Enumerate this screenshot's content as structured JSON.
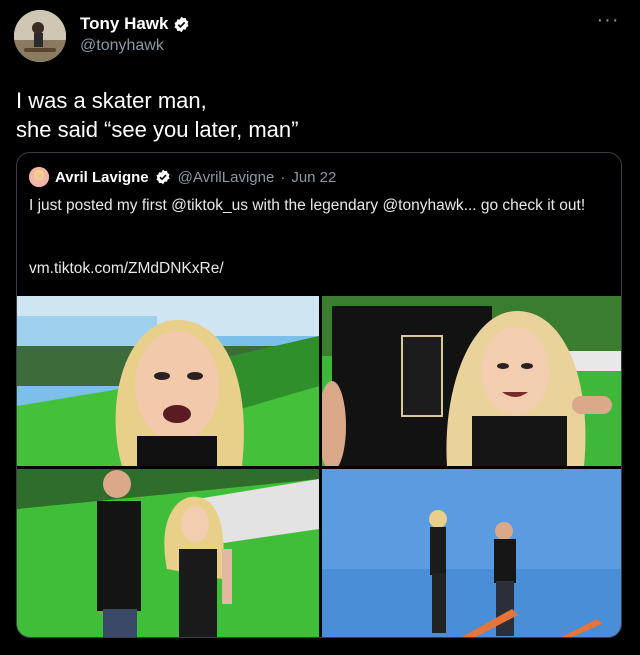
{
  "author": {
    "name": "Tony Hawk",
    "handle": "@tonyhawk",
    "verified": true
  },
  "tweet": {
    "lines": [
      "I was a skater man,",
      "she said “see you later, man”"
    ]
  },
  "quoted": {
    "name": "Avril Lavigne",
    "handle": "@AvrilLavigne",
    "separator": "·",
    "date": "Jun 22",
    "text": "I just posted my first @tiktok_us with the legendary @tonyhawk... go check it out!",
    "link": "vm.tiktok.com/ZMdDNKxRe/"
  },
  "icons": {
    "more": "more-horizontal-icon",
    "verified": "verified-badge-icon"
  },
  "colors": {
    "background": "#000000",
    "verified": "#ffffff",
    "secondary_text": "#8b98a5",
    "green_ramp": "#3cc23a",
    "sky": "#4a90d9"
  }
}
